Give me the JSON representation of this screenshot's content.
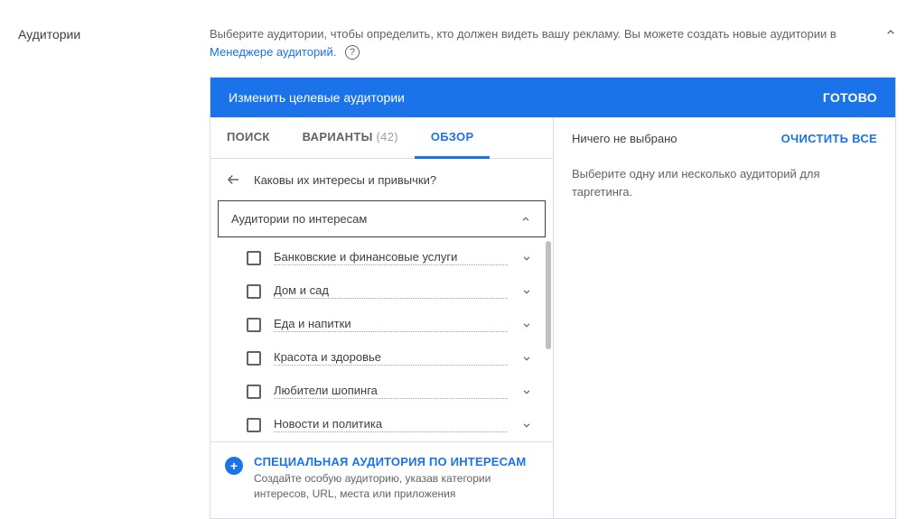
{
  "section": {
    "title": "Аудитории"
  },
  "intro": {
    "text_before_link": "Выберите аудитории, чтобы определить, кто должен видеть вашу рекламу.  Вы можете создать новые аудитории в ",
    "link": "Менеджере аудиторий",
    "text_after_link": "."
  },
  "panel": {
    "header_title": "Изменить целевые аудитории",
    "done_label": "ГОТОВО"
  },
  "tabs": {
    "search": "ПОИСК",
    "variants_label": "ВАРИАНТЫ",
    "variants_count": "(42)",
    "browse": "ОБЗОР"
  },
  "breadcrumb": {
    "question": "Каковы их интересы и привычки?"
  },
  "category": {
    "header": "Аудитории по интересам",
    "items": [
      "Банковские и финансовые услуги",
      "Дом и сад",
      "Еда и напитки",
      "Красота и здоровье",
      "Любители шопинга",
      "Новости и политика"
    ]
  },
  "custom_audience": {
    "title": "СПЕЦИАЛЬНАЯ АУДИТОРИЯ ПО ИНТЕРЕСАМ",
    "subtitle": "Создайте особую аудиторию, указав категории интересов, URL, места или приложения"
  },
  "side": {
    "nothing_selected": "Ничего не выбрано",
    "clear_all": "ОЧИСТИТЬ ВСЕ",
    "hint": "Выберите одну или несколько аудиторий для таргетинга."
  }
}
